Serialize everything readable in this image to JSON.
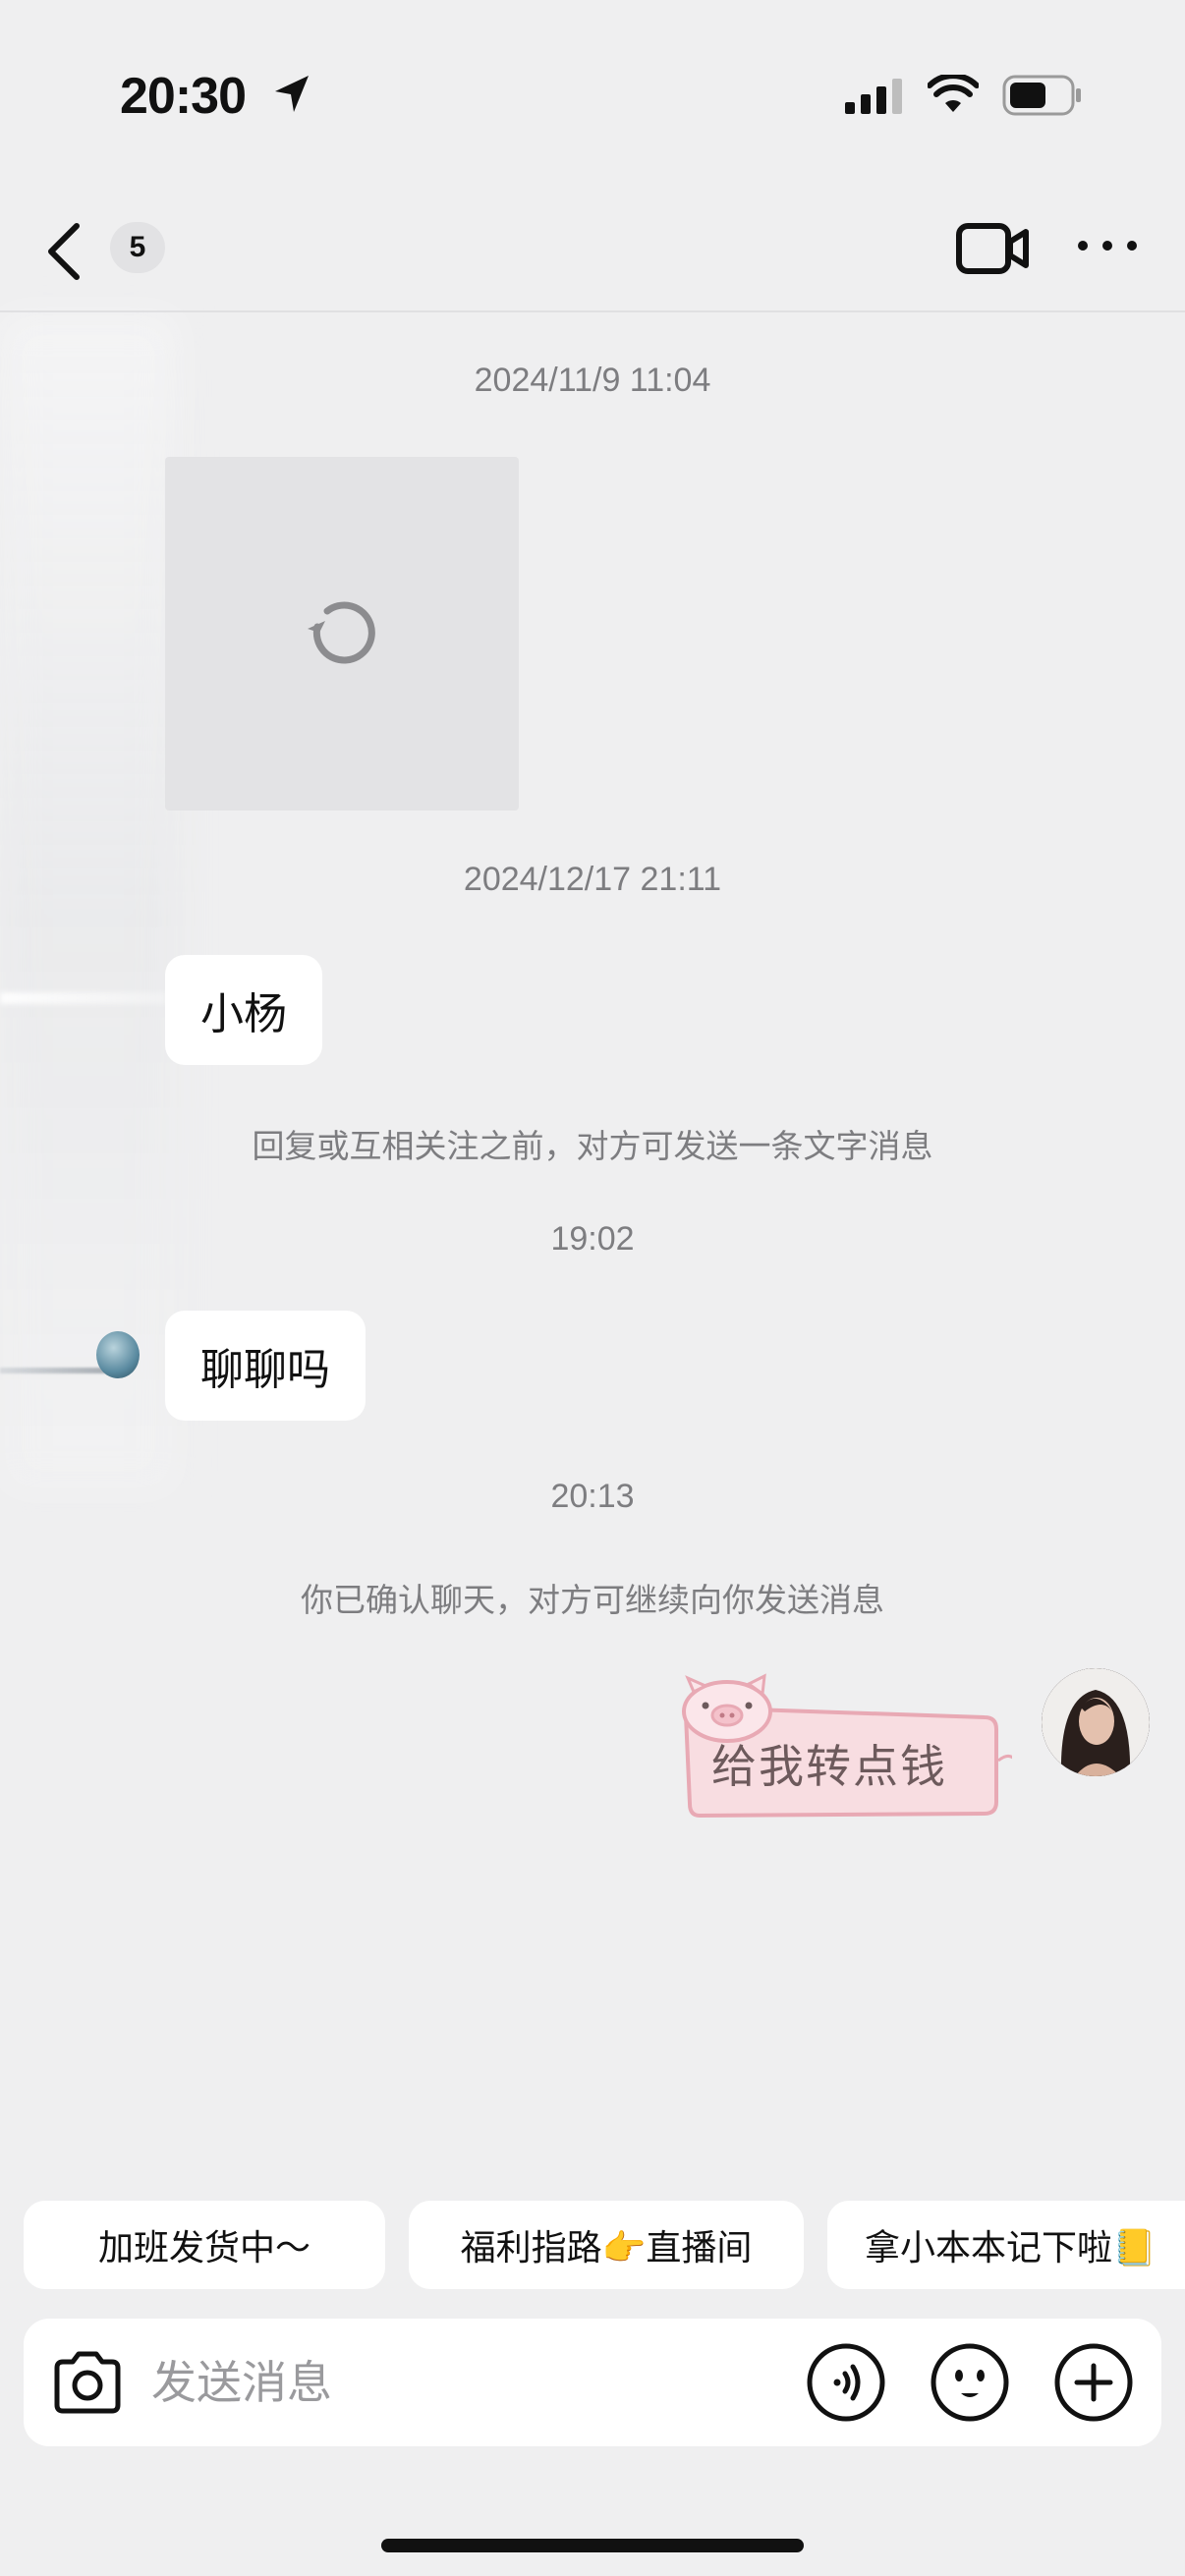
{
  "status_bar": {
    "time": "20:30",
    "icons": [
      "location-arrow-icon",
      "cellular-signal-icon",
      "wifi-icon",
      "battery-icon"
    ]
  },
  "nav": {
    "back_icon": "chevron-left-icon",
    "unread_count": "5",
    "video_call_icon": "video-camera-icon",
    "more_icon": "ellipsis-icon"
  },
  "messages": {
    "ts1": "2024/11/9 11:04",
    "image_loading_icon": "refresh-icon",
    "ts2": "2024/12/17 21:11",
    "msg1": "小杨",
    "notice1": "回复或互相关注之前，对方可发送一条文字消息",
    "ts3": "19:02",
    "msg2": "聊聊吗",
    "ts4": "20:13",
    "notice2": "你已确认聊天，对方可继续向你发送消息",
    "sticker_text": "给我转点钱"
  },
  "quick_replies": [
    "加班发货中～",
    "福利指路👉直播间",
    "拿小本本记下啦📒"
  ],
  "input": {
    "placeholder": "发送消息",
    "camera_icon": "camera-icon",
    "voice_icon": "voice-icon",
    "emoji_icon": "emoji-icon",
    "plus_icon": "plus-icon"
  },
  "colors": {
    "background": "#efeff0",
    "bubble": "#ffffff",
    "sticker_pink": "#f6d2d8",
    "sticker_border": "#e8a9b4",
    "sticker_text": "#6d5a5c"
  }
}
